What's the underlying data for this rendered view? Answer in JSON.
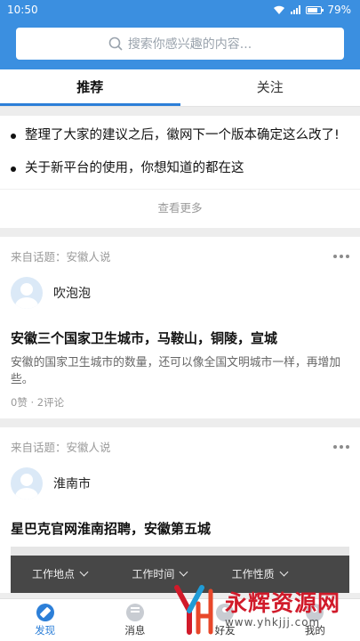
{
  "status_bar": {
    "time": "10:50",
    "battery": "79%"
  },
  "search": {
    "placeholder": "搜索你感兴趣的内容..."
  },
  "tabs": [
    {
      "label": "推荐",
      "active": true
    },
    {
      "label": "关注",
      "active": false
    }
  ],
  "notices": {
    "items": [
      {
        "text": "整理了大家的建议之后，徽网下一个版本确定这么改了!"
      },
      {
        "text": "关于新平台的使用，你想知道的都在这"
      }
    ],
    "view_more": "查看更多"
  },
  "posts": [
    {
      "topic": "来自话题：安徽人说",
      "author": "吹泡泡",
      "title": "安徽三个国家卫生城市，马鞍山，铜陵，宣城",
      "excerpt": "安徽的国家卫生城市的数量，还可以像全国文明城市一样，再增加些。",
      "stats": "0赞 · 2评论"
    },
    {
      "topic": "来自话题：安徽人说",
      "author": "淮南市",
      "title": "星巴克官网淮南招聘，安徽第五城",
      "job_filters": [
        "工作地点",
        "工作时间",
        "工作性质"
      ]
    }
  ],
  "bottom_nav": [
    {
      "label": "发现",
      "icon": "compass-icon",
      "active": true
    },
    {
      "label": "消息",
      "icon": "chat-icon",
      "active": false
    },
    {
      "label": "好友",
      "icon": "people-icon",
      "active": false
    },
    {
      "label": "我的",
      "icon": "user-icon",
      "active": false
    }
  ],
  "watermark": {
    "title": "永辉资源网",
    "url": "www.yhkjjj.com"
  },
  "colors": {
    "brand": "#3b8fe0",
    "accent": "#2c7fd8",
    "watermark_red": "#d11a2a"
  }
}
